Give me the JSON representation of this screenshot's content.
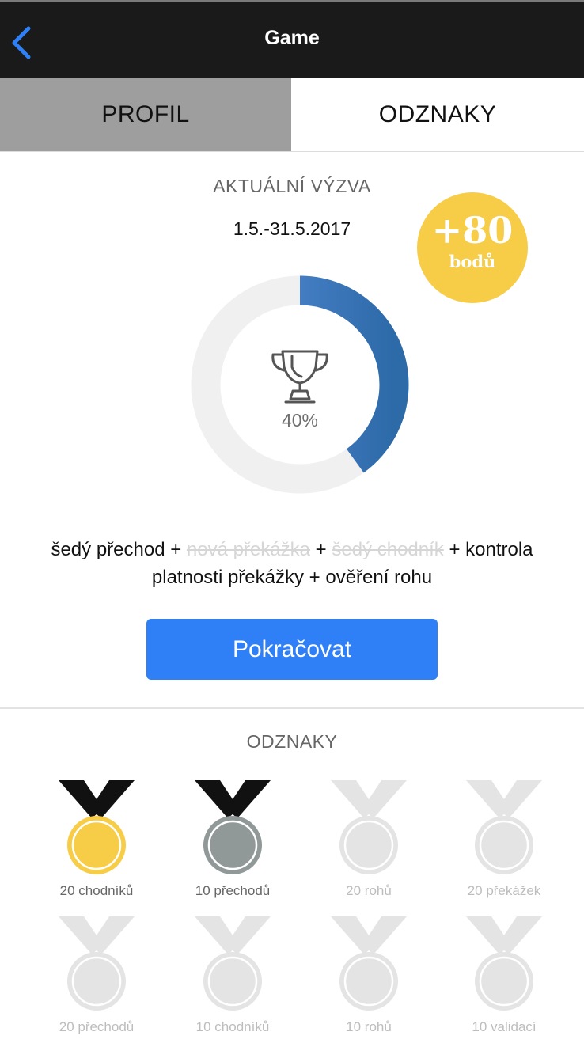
{
  "header": {
    "title": "Game",
    "back_icon": "chevron-left-icon",
    "back_color": "#2f80f7"
  },
  "tabs": [
    {
      "label": "PROFIL",
      "active": false
    },
    {
      "label": "ODZNAKY",
      "active": true
    }
  ],
  "challenge": {
    "heading": "AKTUÁLNÍ VÝZVA",
    "date_range": "1.5.-31.5.2017",
    "points_value": "+80",
    "points_unit": "bodů",
    "progress_fraction": 0.4,
    "progress_label": "40%",
    "icon": "trophy-icon",
    "tasks": [
      {
        "text": "šedý přechod",
        "done": false
      },
      {
        "text": "nová překážka",
        "done": true
      },
      {
        "text": "šedý chodník",
        "done": true
      },
      {
        "text": "kontrola platnosti překážky",
        "done": false
      },
      {
        "text": "ověření rohu",
        "done": false
      }
    ],
    "task_separator": " + ",
    "continue_label": "Pokračovat"
  },
  "badges_section": {
    "heading": "ODZNAKY",
    "badges": [
      {
        "label": "20 chodníků",
        "state": "gold"
      },
      {
        "label": "10 přechodů",
        "state": "silver"
      },
      {
        "label": "20 rohů",
        "state": "locked"
      },
      {
        "label": "20 překážek",
        "state": "locked"
      },
      {
        "label": "20 přechodů",
        "state": "locked"
      },
      {
        "label": "10 chodníků",
        "state": "locked"
      },
      {
        "label": "10 rohů",
        "state": "locked"
      },
      {
        "label": "10 validací",
        "state": "locked"
      }
    ]
  },
  "colors": {
    "topbar": "#1a1a1a",
    "accent": "#2f80f7",
    "progress_start": "#5a8fdd",
    "progress_end": "#2d6aa8",
    "points_badge": "#f7cc47",
    "gold_medal": "#f7cc47",
    "silver_medal": "#909898",
    "locked_medal": "#e4e4e4"
  }
}
